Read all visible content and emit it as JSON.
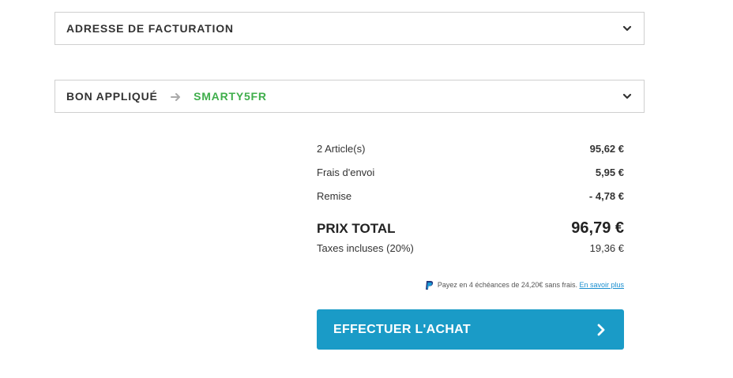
{
  "billing_panel": {
    "title": "ADRESSE DE FACTURATION"
  },
  "voucher_panel": {
    "title": "BON APPLIQUÉ",
    "code": "SMARTY5FR"
  },
  "summary": {
    "articles_label": "2 Article(s)",
    "articles_value": "95,62 €",
    "shipping_label": "Frais d'envoi",
    "shipping_value": "5,95 €",
    "discount_label": "Remise",
    "discount_value": "- 4,78 €",
    "total_label": "PRIX TOTAL",
    "total_value": "96,79 €",
    "tax_label": "Taxes incluses (20%)",
    "tax_value": "19,36 €"
  },
  "paypal": {
    "text": "Payez en 4 échéances de 24,20€ sans frais.",
    "link": "En savoir plus"
  },
  "checkout": {
    "label": "EFFECTUER L'ACHAT"
  },
  "colors": {
    "accent": "#1a9bc7",
    "voucher": "#3fae4b",
    "border": "#cfcfcf"
  }
}
